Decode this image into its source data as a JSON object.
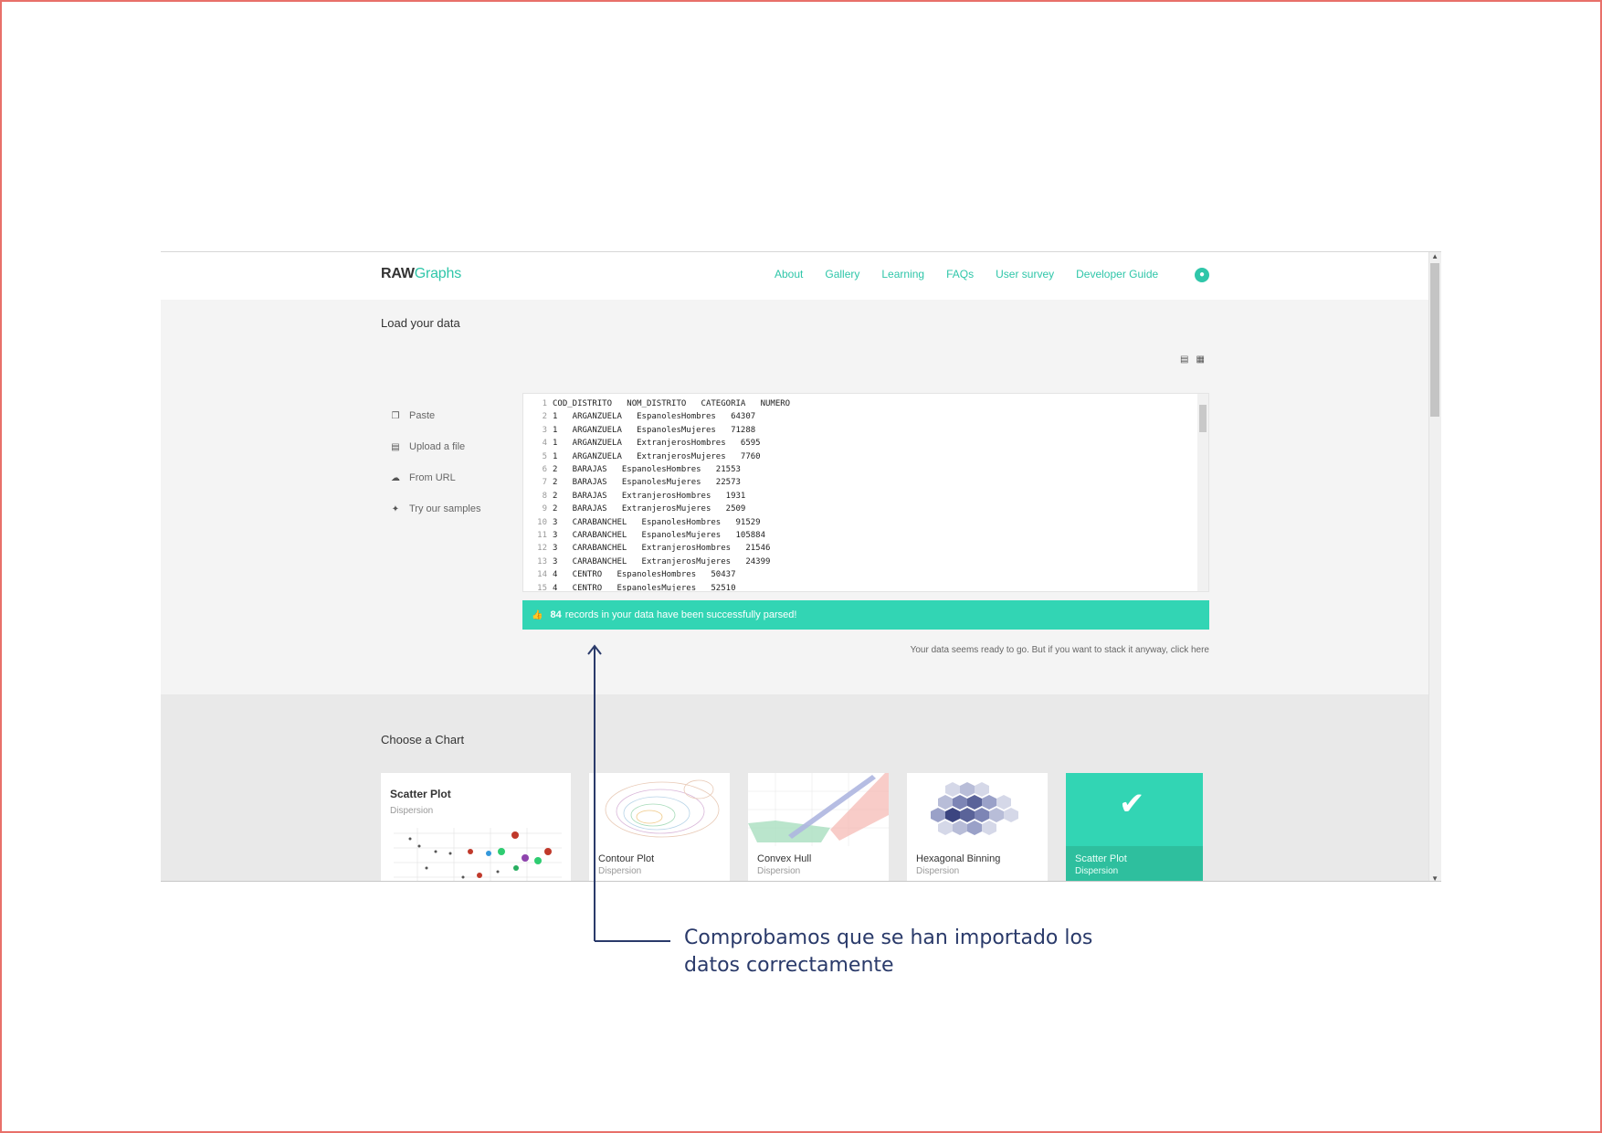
{
  "brand": {
    "part1": "RAW",
    "part2": "Graphs"
  },
  "nav": {
    "links": [
      "About",
      "Gallery",
      "Learning",
      "FAQs",
      "User survey",
      "Developer Guide"
    ],
    "github_icon": "github-icon"
  },
  "load": {
    "title": "Load your data",
    "menu": [
      {
        "icon": "paste-icon",
        "label": "Paste"
      },
      {
        "icon": "file-icon",
        "label": "Upload a file"
      },
      {
        "icon": "cloud-icon",
        "label": "From URL"
      },
      {
        "icon": "gift-icon",
        "label": "Try our samples"
      }
    ],
    "editor_lines": [
      "COD_DISTRITO   NOM_DISTRITO   CATEGORIA   NUMERO",
      "1   ARGANZUELA   EspanolesHombres   64307",
      "1   ARGANZUELA   EspanolesMujeres   71288",
      "1   ARGANZUELA   ExtranjerosHombres   6595",
      "1   ARGANZUELA   ExtranjerosMujeres   7760",
      "2   BARAJAS   EspanolesHombres   21553",
      "2   BARAJAS   EspanolesMujeres   22573",
      "2   BARAJAS   ExtranjerosHombres   1931",
      "2   BARAJAS   ExtranjerosMujeres   2509",
      "3   CARABANCHEL   EspanolesHombres   91529",
      "3   CARABANCHEL   EspanolesMujeres   105884",
      "3   CARABANCHEL   ExtranjerosHombres   21546",
      "3   CARABANCHEL   ExtranjerosMujeres   24399",
      "4   CENTRO   EspanolesHombres   50437",
      "4   CENTRO   EspanolesMujeres   52510"
    ],
    "success": {
      "count": "84",
      "message": "records in your data have been successfully parsed!"
    },
    "stack_note": "Your data seems ready to go. But if you want to stack it anyway,",
    "stack_link": "click here"
  },
  "charts": {
    "title": "Choose a Chart",
    "cards": [
      {
        "title": "Scatter Plot",
        "subtitle": "Dispersion"
      },
      {
        "title": "Contour Plot",
        "subtitle": "Dispersion"
      },
      {
        "title": "Convex Hull",
        "subtitle": "Dispersion"
      },
      {
        "title": "Hexagonal Binning",
        "subtitle": "Dispersion"
      },
      {
        "title": "Scatter Plot",
        "subtitle": "Dispersion",
        "selected": true
      }
    ]
  },
  "annotation": {
    "line1": "Comprobamos que se han importado los",
    "line2": "datos correctamente"
  },
  "colors": {
    "accent": "#2fc6a9",
    "success": "#32d5b4",
    "annotation": "#2a3a6a",
    "frame": "#e8706a"
  }
}
